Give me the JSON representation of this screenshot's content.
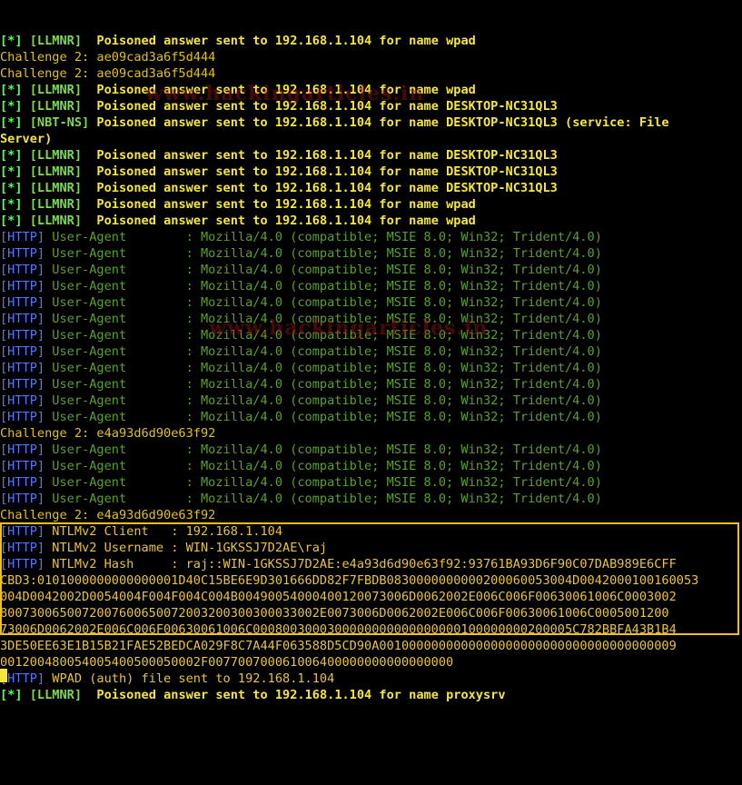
{
  "terminal": {
    "watermark": "www.hackingarticles.in",
    "lines": [
      {
        "kind": "poison",
        "tag": "[*]",
        "proto": "[LLMNR]",
        "text": "Poisoned answer sent to 192.168.1.104 for name wpad"
      },
      {
        "kind": "plain",
        "text": "Challenge 2: ae09cad3a6f5d444"
      },
      {
        "kind": "plain",
        "text": "Challenge 2: ae09cad3a6f5d444"
      },
      {
        "kind": "poison",
        "tag": "[*]",
        "proto": "[LLMNR]",
        "text": "Poisoned answer sent to 192.168.1.104 for name wpad"
      },
      {
        "kind": "poison",
        "tag": "[*]",
        "proto": "[LLMNR]",
        "text": "Poisoned answer sent to 192.168.1.104 for name DESKTOP-NC31QL3"
      },
      {
        "kind": "poison",
        "tag": "[*]",
        "proto": "[NBT-NS]",
        "text": "Poisoned answer sent to 192.168.1.104 for name DESKTOP-NC31QL3 (service: File"
      },
      {
        "kind": "cont",
        "text": "Server)"
      },
      {
        "kind": "poison",
        "tag": "[*]",
        "proto": "[LLMNR]",
        "text": "Poisoned answer sent to 192.168.1.104 for name DESKTOP-NC31QL3"
      },
      {
        "kind": "poison",
        "tag": "[*]",
        "proto": "[LLMNR]",
        "text": "Poisoned answer sent to 192.168.1.104 for name DESKTOP-NC31QL3"
      },
      {
        "kind": "poison",
        "tag": "[*]",
        "proto": "[LLMNR]",
        "text": "Poisoned answer sent to 192.168.1.104 for name DESKTOP-NC31QL3"
      },
      {
        "kind": "poison",
        "tag": "[*]",
        "proto": "[LLMNR]",
        "text": "Poisoned answer sent to 192.168.1.104 for name wpad"
      },
      {
        "kind": "poison",
        "tag": "[*]",
        "proto": "[LLMNR]",
        "text": "Poisoned answer sent to 192.168.1.104 for name wpad"
      },
      {
        "kind": "ua",
        "tag": "[HTTP]",
        "text": "User-Agent        : Mozilla/4.0 (compatible; MSIE 8.0; Win32; Trident/4.0)"
      },
      {
        "kind": "ua",
        "tag": "[HTTP]",
        "text": "User-Agent        : Mozilla/4.0 (compatible; MSIE 8.0; Win32; Trident/4.0)"
      },
      {
        "kind": "ua",
        "tag": "[HTTP]",
        "text": "User-Agent        : Mozilla/4.0 (compatible; MSIE 8.0; Win32; Trident/4.0)"
      },
      {
        "kind": "ua",
        "tag": "[HTTP]",
        "text": "User-Agent        : Mozilla/4.0 (compatible; MSIE 8.0; Win32; Trident/4.0)"
      },
      {
        "kind": "ua",
        "tag": "[HTTP]",
        "text": "User-Agent        : Mozilla/4.0 (compatible; MSIE 8.0; Win32; Trident/4.0)"
      },
      {
        "kind": "ua",
        "tag": "[HTTP]",
        "text": "User-Agent        : Mozilla/4.0 (compatible; MSIE 8.0; Win32; Trident/4.0)"
      },
      {
        "kind": "ua",
        "tag": "[HTTP]",
        "text": "User-Agent        : Mozilla/4.0 (compatible; MSIE 8.0; Win32; Trident/4.0)"
      },
      {
        "kind": "ua",
        "tag": "[HTTP]",
        "text": "User-Agent        : Mozilla/4.0 (compatible; MSIE 8.0; Win32; Trident/4.0)"
      },
      {
        "kind": "ua",
        "tag": "[HTTP]",
        "text": "User-Agent        : Mozilla/4.0 (compatible; MSIE 8.0; Win32; Trident/4.0)"
      },
      {
        "kind": "ua",
        "tag": "[HTTP]",
        "text": "User-Agent        : Mozilla/4.0 (compatible; MSIE 8.0; Win32; Trident/4.0)"
      },
      {
        "kind": "ua",
        "tag": "[HTTP]",
        "text": "User-Agent        : Mozilla/4.0 (compatible; MSIE 8.0; Win32; Trident/4.0)"
      },
      {
        "kind": "ua",
        "tag": "[HTTP]",
        "text": "User-Agent        : Mozilla/4.0 (compatible; MSIE 8.0; Win32; Trident/4.0)"
      },
      {
        "kind": "plain",
        "text": "Challenge 2: e4a93d6d90e63f92"
      },
      {
        "kind": "ua",
        "tag": "[HTTP]",
        "text": "User-Agent        : Mozilla/4.0 (compatible; MSIE 8.0; Win32; Trident/4.0)"
      },
      {
        "kind": "ua",
        "tag": "[HTTP]",
        "text": "User-Agent        : Mozilla/4.0 (compatible; MSIE 8.0; Win32; Trident/4.0)"
      },
      {
        "kind": "ua",
        "tag": "[HTTP]",
        "text": "User-Agent        : Mozilla/4.0 (compatible; MSIE 8.0; Win32; Trident/4.0)"
      },
      {
        "kind": "ua",
        "tag": "[HTTP]",
        "text": "User-Agent        : Mozilla/4.0 (compatible; MSIE 8.0; Win32; Trident/4.0)"
      },
      {
        "kind": "plain",
        "text": "Challenge 2: e4a93d6d90e63f92"
      },
      {
        "kind": "http",
        "tag": "[HTTP]",
        "text": "NTLMv2 Client   : 192.168.1.104"
      },
      {
        "kind": "http",
        "tag": "[HTTP]",
        "text": "NTLMv2 Username : WIN-1GKSSJ7D2AE\\raj"
      },
      {
        "kind": "http",
        "tag": "[HTTP]",
        "text": "NTLMv2 Hash     : raj::WIN-1GKSSJ7D2AE:e4a93d6d90e63f92:93761BA93D6F90C07DAB989E6CFF"
      },
      {
        "kind": "hash",
        "text": "CBD3:0101000000000000001D40C15BE6E9D301666DD82F7FBDB0830000000000200060053004D0042000100160053"
      },
      {
        "kind": "hash",
        "text": "004D0042002D0054004F004F004C004B00490054000400120073006D0062002E006C006F00630061006C0003002"
      },
      {
        "kind": "hash",
        "text": "8007300650072007600650072003200300300033002E0073006D0062002E006C006F00630061006C0005001200"
      },
      {
        "kind": "hash",
        "text": "73006D0062002E006C006F00630061006C0008003000300000000000000000100000000200005C782BBFA43B1B4"
      },
      {
        "kind": "hash",
        "text": "3DE50EE63E1B15B21FAE52BEDCA029F8C7A44F063588D5CD90A0010000000000000000000000000000000000009"
      },
      {
        "kind": "hash",
        "text": "001200480054005400500050002F007700700061006400000000000000000"
      },
      {
        "kind": "http",
        "tag": "[HTTP]",
        "text": "WPAD (auth) file sent to 192.168.1.104"
      },
      {
        "kind": "poison",
        "tag": "[*]",
        "proto": "[LLMNR]",
        "text": "Poisoned answer sent to 192.168.1.104 for name proxysrv"
      }
    ]
  },
  "colors": {
    "background": "#000000",
    "star_tag": "#55ff55",
    "http_tag": "#5577ff",
    "proto": "#7ed957",
    "poison_text": "#f7e640",
    "challenge_text": "#e0c020",
    "user_agent_text": "#5aa02c",
    "ntlm_text": "#e8c244",
    "highlight_box": "#f2c01a"
  }
}
